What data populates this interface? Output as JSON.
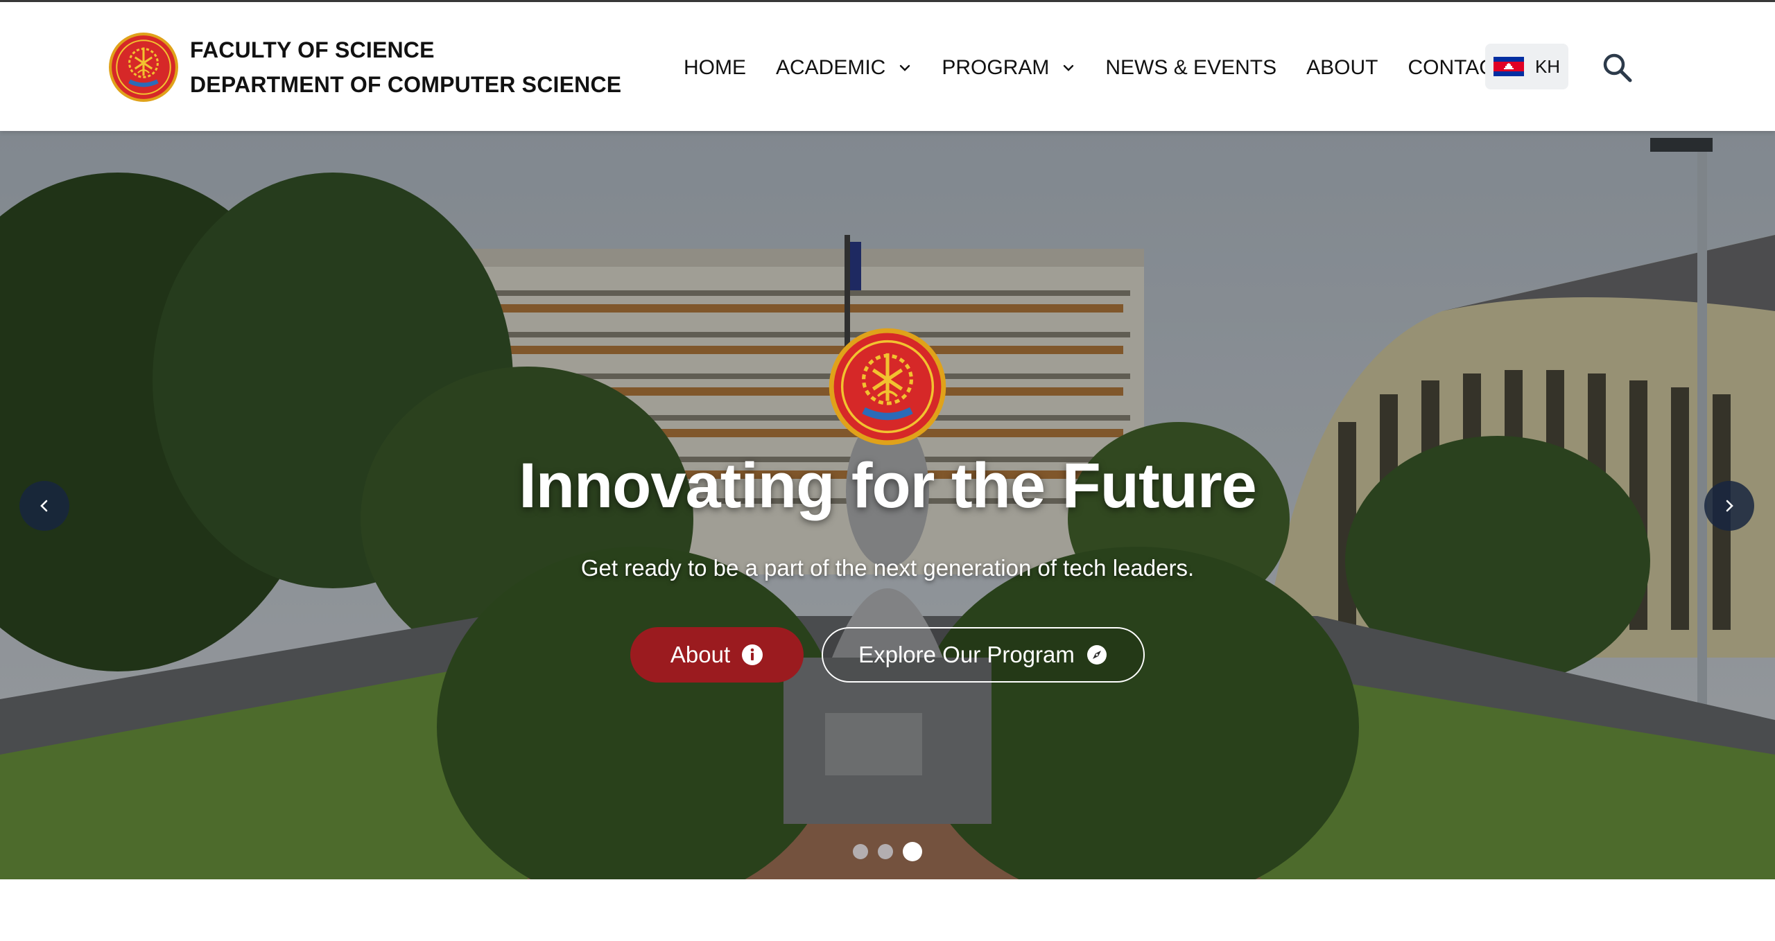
{
  "brand": {
    "line1": "FACULTY OF SCIENCE",
    "line2": "DEPARTMENT OF COMPUTER SCIENCE",
    "logo_icon": "university-emblem-icon"
  },
  "nav": {
    "items": [
      {
        "label": "HOME",
        "has_dropdown": false
      },
      {
        "label": "ACADEMIC",
        "has_dropdown": true
      },
      {
        "label": "PROGRAM",
        "has_dropdown": true
      },
      {
        "label": "NEWS & EVENTS",
        "has_dropdown": false
      },
      {
        "label": "ABOUT",
        "has_dropdown": false
      },
      {
        "label": "CONTACT",
        "has_dropdown": false
      }
    ],
    "language": {
      "label": "KH",
      "flag_icon": "cambodia-flag-icon"
    },
    "search_icon": "search-icon"
  },
  "hero": {
    "title": "Innovating for the Future",
    "subtitle": "Get ready to be a part of the next generation of tech leaders.",
    "primary_button": {
      "label": "About",
      "icon": "info-circle-icon"
    },
    "secondary_button": {
      "label": "Explore Our Program",
      "icon": "compass-icon"
    },
    "slides_total": 3,
    "active_slide": 3
  },
  "colors": {
    "accent": "#9b1b1f",
    "arrow_bg": "#172640",
    "nav_text": "#111111"
  }
}
